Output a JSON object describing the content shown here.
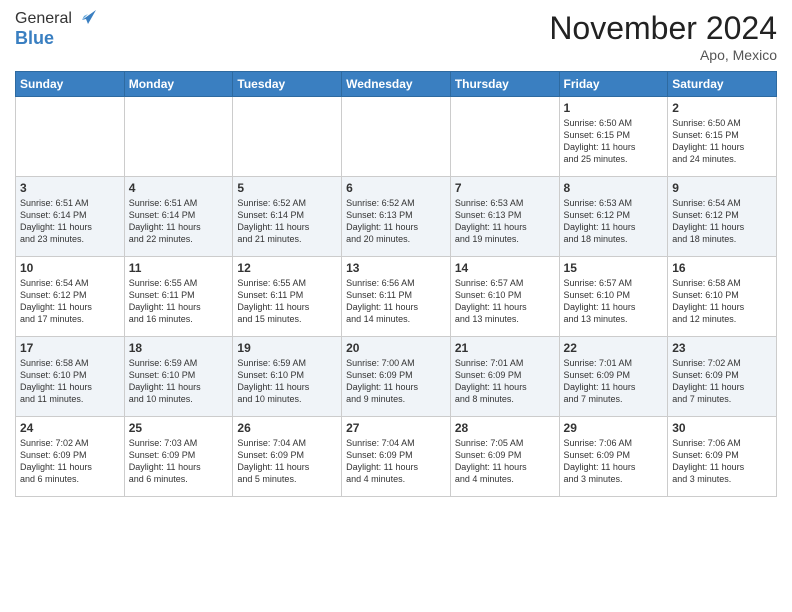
{
  "logo": {
    "general": "General",
    "blue": "Blue"
  },
  "header": {
    "month": "November 2024",
    "location": "Apo, Mexico"
  },
  "weekdays": [
    "Sunday",
    "Monday",
    "Tuesday",
    "Wednesday",
    "Thursday",
    "Friday",
    "Saturday"
  ],
  "weeks": [
    [
      {
        "day": "",
        "info": ""
      },
      {
        "day": "",
        "info": ""
      },
      {
        "day": "",
        "info": ""
      },
      {
        "day": "",
        "info": ""
      },
      {
        "day": "",
        "info": ""
      },
      {
        "day": "1",
        "info": "Sunrise: 6:50 AM\nSunset: 6:15 PM\nDaylight: 11 hours\nand 25 minutes."
      },
      {
        "day": "2",
        "info": "Sunrise: 6:50 AM\nSunset: 6:15 PM\nDaylight: 11 hours\nand 24 minutes."
      }
    ],
    [
      {
        "day": "3",
        "info": "Sunrise: 6:51 AM\nSunset: 6:14 PM\nDaylight: 11 hours\nand 23 minutes."
      },
      {
        "day": "4",
        "info": "Sunrise: 6:51 AM\nSunset: 6:14 PM\nDaylight: 11 hours\nand 22 minutes."
      },
      {
        "day": "5",
        "info": "Sunrise: 6:52 AM\nSunset: 6:14 PM\nDaylight: 11 hours\nand 21 minutes."
      },
      {
        "day": "6",
        "info": "Sunrise: 6:52 AM\nSunset: 6:13 PM\nDaylight: 11 hours\nand 20 minutes."
      },
      {
        "day": "7",
        "info": "Sunrise: 6:53 AM\nSunset: 6:13 PM\nDaylight: 11 hours\nand 19 minutes."
      },
      {
        "day": "8",
        "info": "Sunrise: 6:53 AM\nSunset: 6:12 PM\nDaylight: 11 hours\nand 18 minutes."
      },
      {
        "day": "9",
        "info": "Sunrise: 6:54 AM\nSunset: 6:12 PM\nDaylight: 11 hours\nand 18 minutes."
      }
    ],
    [
      {
        "day": "10",
        "info": "Sunrise: 6:54 AM\nSunset: 6:12 PM\nDaylight: 11 hours\nand 17 minutes."
      },
      {
        "day": "11",
        "info": "Sunrise: 6:55 AM\nSunset: 6:11 PM\nDaylight: 11 hours\nand 16 minutes."
      },
      {
        "day": "12",
        "info": "Sunrise: 6:55 AM\nSunset: 6:11 PM\nDaylight: 11 hours\nand 15 minutes."
      },
      {
        "day": "13",
        "info": "Sunrise: 6:56 AM\nSunset: 6:11 PM\nDaylight: 11 hours\nand 14 minutes."
      },
      {
        "day": "14",
        "info": "Sunrise: 6:57 AM\nSunset: 6:10 PM\nDaylight: 11 hours\nand 13 minutes."
      },
      {
        "day": "15",
        "info": "Sunrise: 6:57 AM\nSunset: 6:10 PM\nDaylight: 11 hours\nand 13 minutes."
      },
      {
        "day": "16",
        "info": "Sunrise: 6:58 AM\nSunset: 6:10 PM\nDaylight: 11 hours\nand 12 minutes."
      }
    ],
    [
      {
        "day": "17",
        "info": "Sunrise: 6:58 AM\nSunset: 6:10 PM\nDaylight: 11 hours\nand 11 minutes."
      },
      {
        "day": "18",
        "info": "Sunrise: 6:59 AM\nSunset: 6:10 PM\nDaylight: 11 hours\nand 10 minutes."
      },
      {
        "day": "19",
        "info": "Sunrise: 6:59 AM\nSunset: 6:10 PM\nDaylight: 11 hours\nand 10 minutes."
      },
      {
        "day": "20",
        "info": "Sunrise: 7:00 AM\nSunset: 6:09 PM\nDaylight: 11 hours\nand 9 minutes."
      },
      {
        "day": "21",
        "info": "Sunrise: 7:01 AM\nSunset: 6:09 PM\nDaylight: 11 hours\nand 8 minutes."
      },
      {
        "day": "22",
        "info": "Sunrise: 7:01 AM\nSunset: 6:09 PM\nDaylight: 11 hours\nand 7 minutes."
      },
      {
        "day": "23",
        "info": "Sunrise: 7:02 AM\nSunset: 6:09 PM\nDaylight: 11 hours\nand 7 minutes."
      }
    ],
    [
      {
        "day": "24",
        "info": "Sunrise: 7:02 AM\nSunset: 6:09 PM\nDaylight: 11 hours\nand 6 minutes."
      },
      {
        "day": "25",
        "info": "Sunrise: 7:03 AM\nSunset: 6:09 PM\nDaylight: 11 hours\nand 6 minutes."
      },
      {
        "day": "26",
        "info": "Sunrise: 7:04 AM\nSunset: 6:09 PM\nDaylight: 11 hours\nand 5 minutes."
      },
      {
        "day": "27",
        "info": "Sunrise: 7:04 AM\nSunset: 6:09 PM\nDaylight: 11 hours\nand 4 minutes."
      },
      {
        "day": "28",
        "info": "Sunrise: 7:05 AM\nSunset: 6:09 PM\nDaylight: 11 hours\nand 4 minutes."
      },
      {
        "day": "29",
        "info": "Sunrise: 7:06 AM\nSunset: 6:09 PM\nDaylight: 11 hours\nand 3 minutes."
      },
      {
        "day": "30",
        "info": "Sunrise: 7:06 AM\nSunset: 6:09 PM\nDaylight: 11 hours\nand 3 minutes."
      }
    ]
  ]
}
